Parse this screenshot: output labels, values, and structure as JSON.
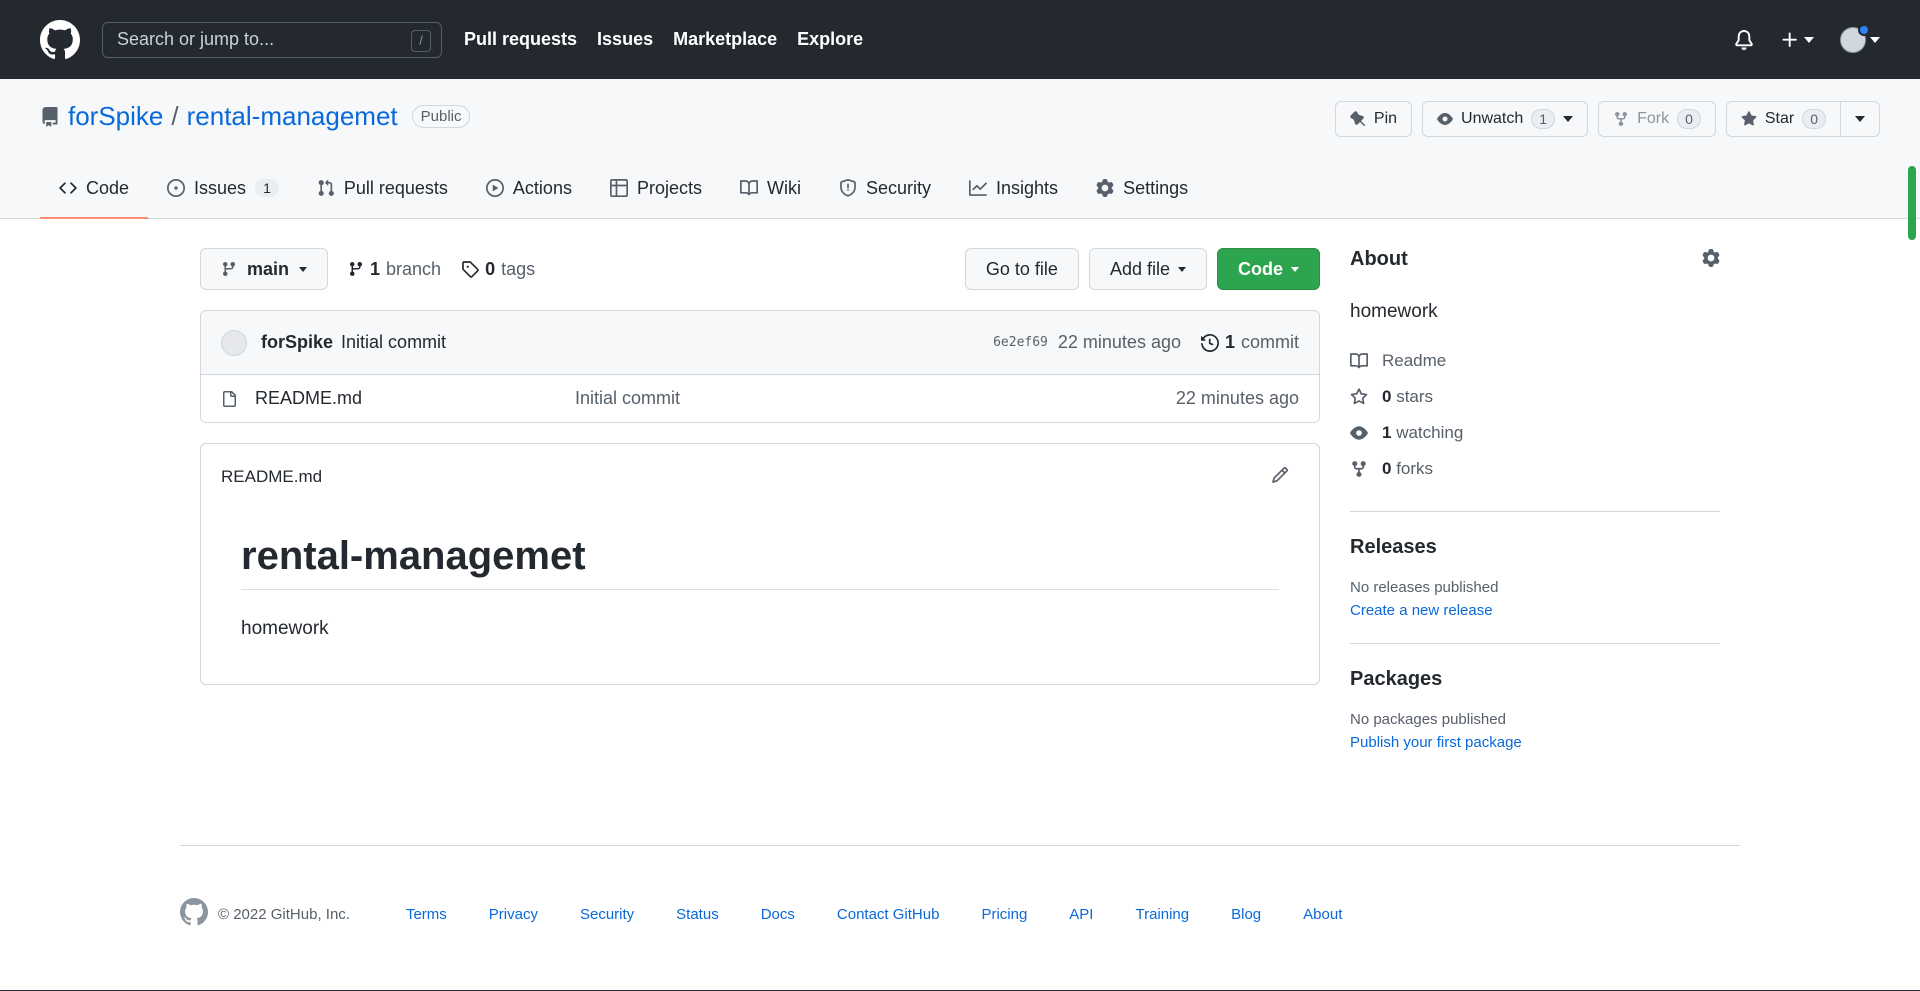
{
  "header": {
    "search_placeholder": "Search or jump to...",
    "search_shortcut": "/",
    "nav": [
      "Pull requests",
      "Issues",
      "Marketplace",
      "Explore"
    ]
  },
  "repo": {
    "owner": "forSpike",
    "separator": "/",
    "name": "rental-managemet",
    "visibility": "Public",
    "pin_label": "Pin",
    "unwatch_label": "Unwatch",
    "unwatch_count": "1",
    "fork_label": "Fork",
    "fork_count": "0",
    "star_label": "Star",
    "star_count": "0"
  },
  "tabs": [
    {
      "label": "Code",
      "icon": "code-icon",
      "active": true
    },
    {
      "label": "Issues",
      "icon": "issue-icon",
      "count": "1"
    },
    {
      "label": "Pull requests",
      "icon": "pull-request-icon"
    },
    {
      "label": "Actions",
      "icon": "play-icon"
    },
    {
      "label": "Projects",
      "icon": "table-icon"
    },
    {
      "label": "Wiki",
      "icon": "book-icon"
    },
    {
      "label": "Security",
      "icon": "shield-icon"
    },
    {
      "label": "Insights",
      "icon": "graph-icon"
    },
    {
      "label": "Settings",
      "icon": "gear-icon"
    }
  ],
  "toolbar": {
    "branch": "main",
    "branch_count": "1",
    "branch_word": "branch",
    "tag_count": "0",
    "tag_word": "tags",
    "go_to_file": "Go to file",
    "add_file": "Add file",
    "code": "Code"
  },
  "commit": {
    "author": "forSpike",
    "message": "Initial commit",
    "sha": "6e2ef69",
    "age": "22 minutes ago",
    "count": "1",
    "count_word": "commit"
  },
  "files": [
    {
      "name": "README.md",
      "message": "Initial commit",
      "age": "22 minutes ago"
    }
  ],
  "readme": {
    "filename": "README.md",
    "heading": "rental-managemet",
    "body": "homework"
  },
  "about": {
    "title": "About",
    "description": "homework",
    "readme": "Readme",
    "stars_count": "0",
    "stars_word": "stars",
    "watching_count": "1",
    "watching_word": "watching",
    "forks_count": "0",
    "forks_word": "forks"
  },
  "releases": {
    "title": "Releases",
    "empty": "No releases published",
    "link": "Create a new release"
  },
  "packages": {
    "title": "Packages",
    "empty": "No packages published",
    "link": "Publish your first package"
  },
  "footer": {
    "copyright": "© 2022 GitHub, Inc.",
    "links": [
      "Terms",
      "Privacy",
      "Security",
      "Status",
      "Docs",
      "Contact GitHub",
      "Pricing",
      "API",
      "Training",
      "Blog",
      "About"
    ]
  },
  "colors": {
    "header_bg": "#24292f",
    "link": "#0969da",
    "green": "#2da44e",
    "active_tab": "#fd8c73"
  }
}
